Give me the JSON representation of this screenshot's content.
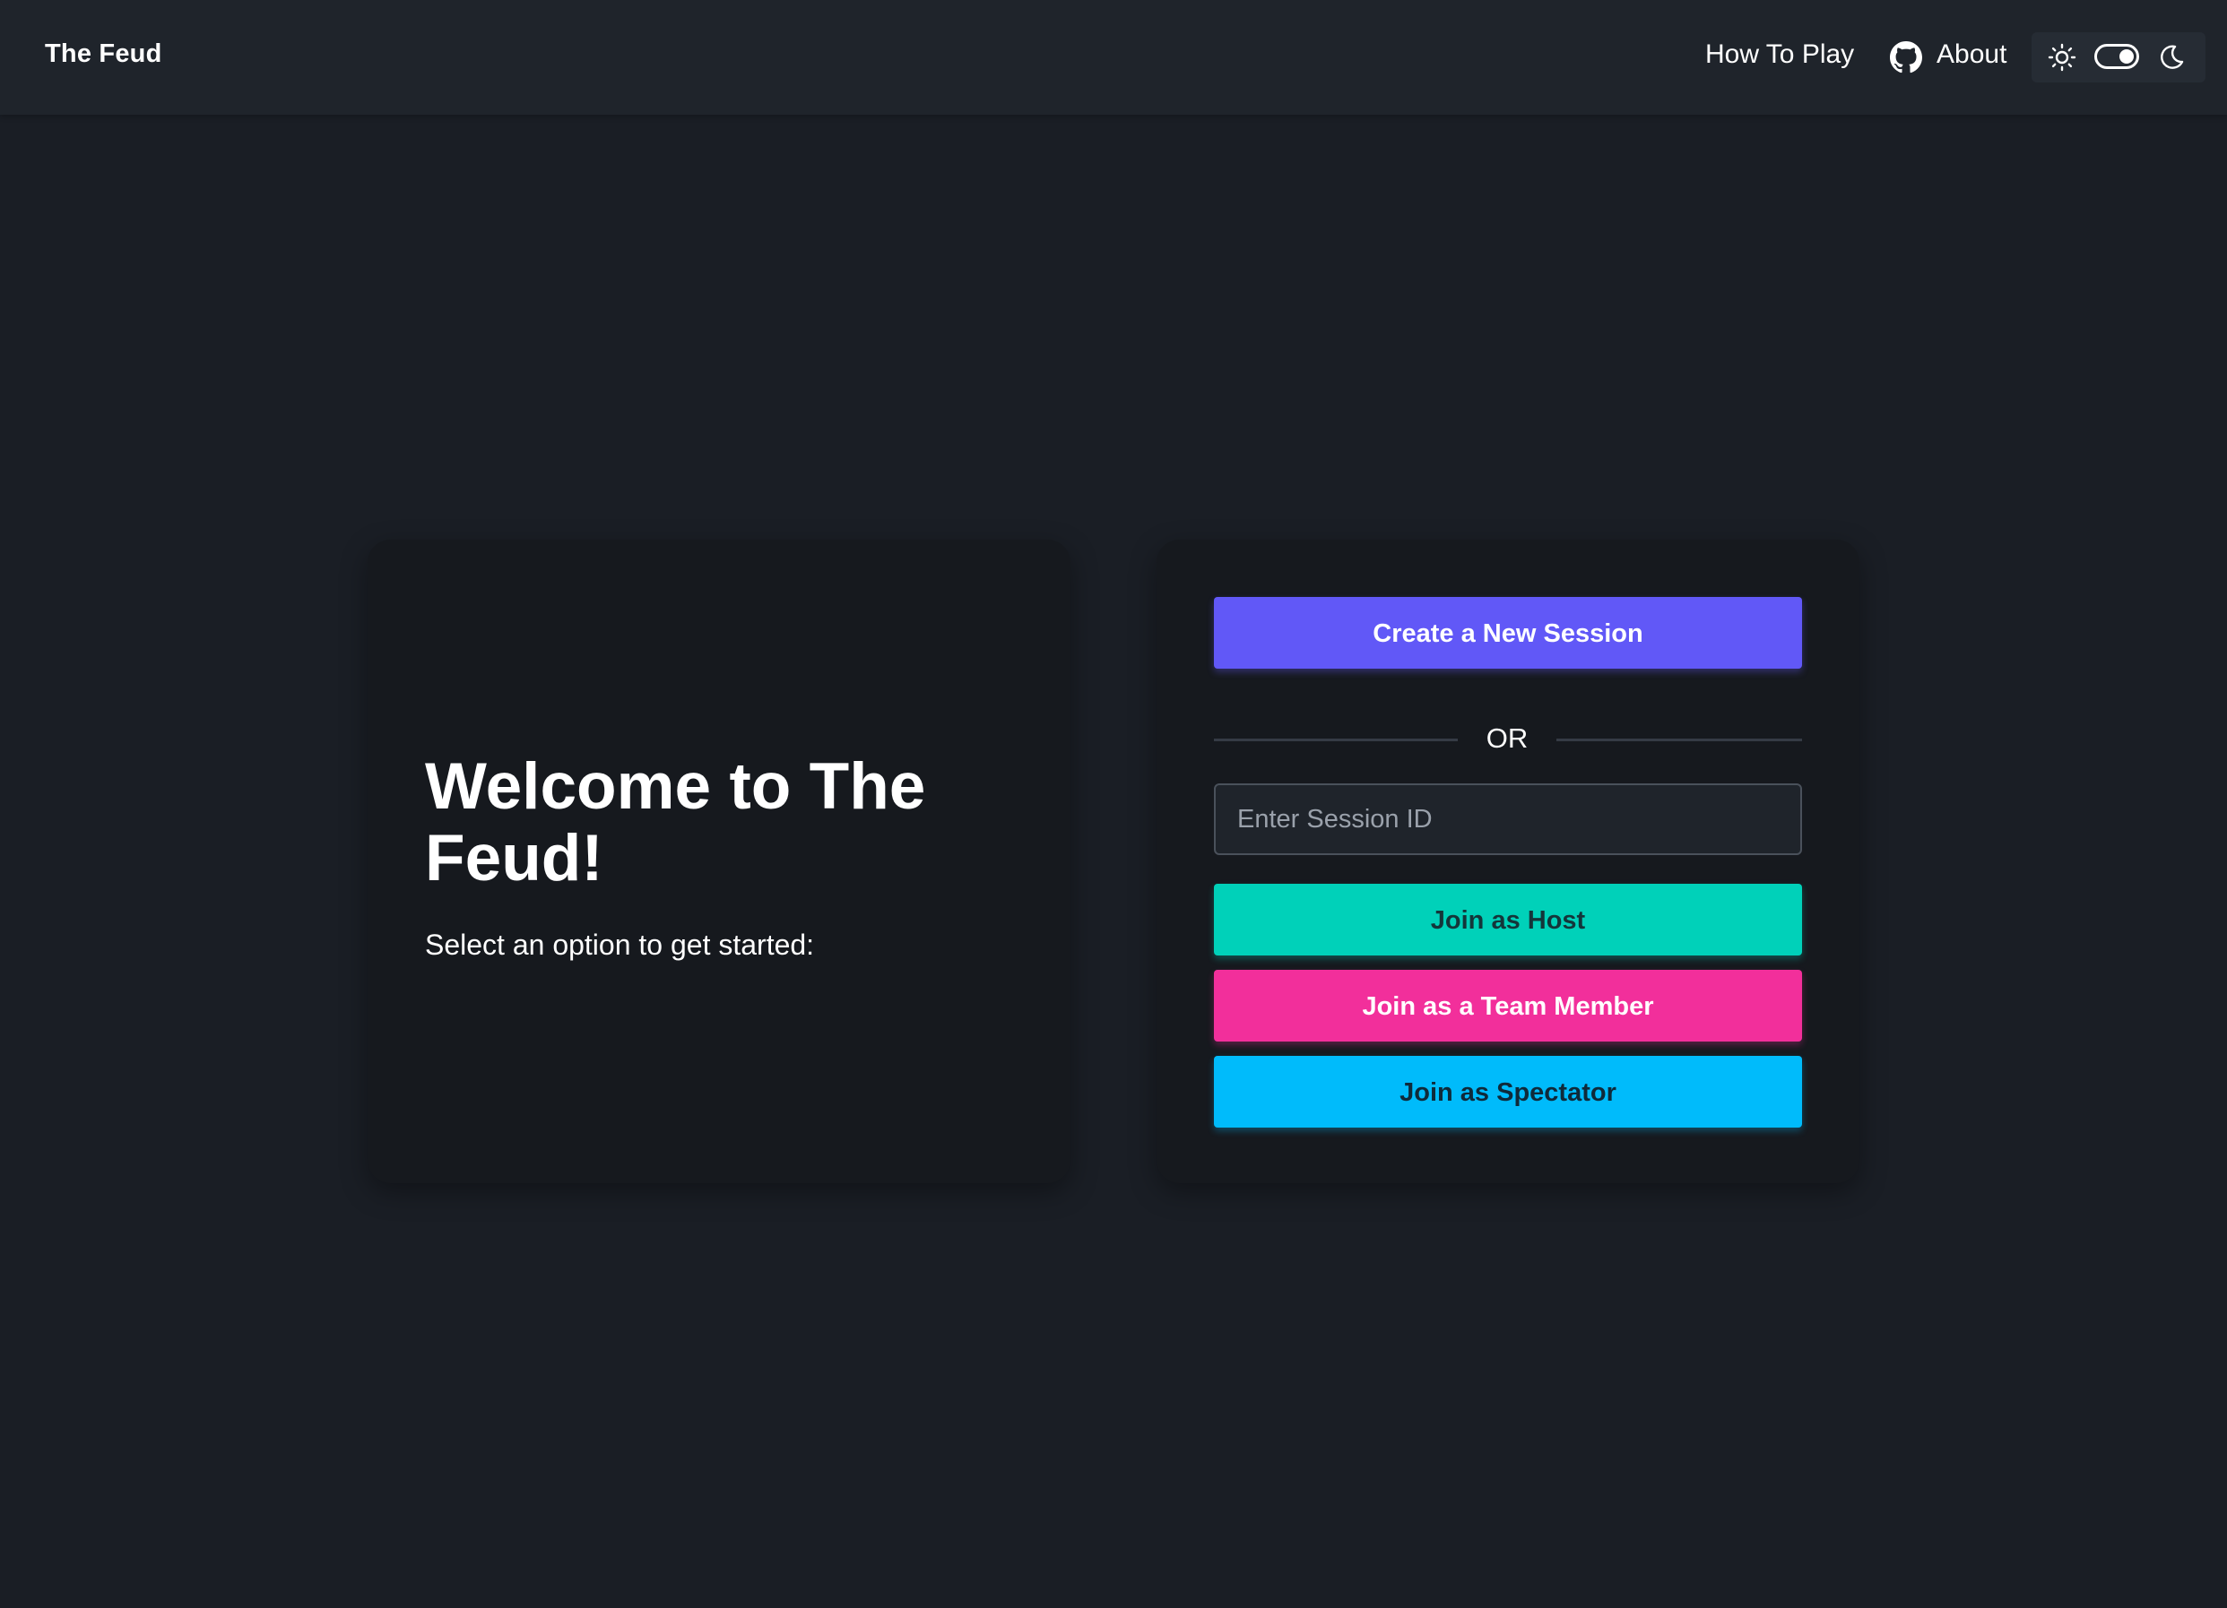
{
  "header": {
    "brand": "The Feud",
    "nav": {
      "how_to_play": "How To Play",
      "about": "About"
    },
    "icons": {
      "github": "github-icon",
      "sun": "sun-icon",
      "moon": "moon-icon"
    },
    "theme_toggle": {
      "state": "dark"
    }
  },
  "welcome": {
    "title": "Welcome to The Feud!",
    "subtitle": "Select an option to get started:"
  },
  "actions": {
    "create_label": "Create a New Session",
    "or_label": "OR",
    "session_input": {
      "placeholder": "Enter Session ID",
      "value": ""
    },
    "join_host_label": "Join as Host",
    "join_team_label": "Join as a Team Member",
    "join_spectator_label": "Join as Spectator"
  },
  "colors": {
    "background": "#1a1e25",
    "navbar": "#1f242b",
    "card": "#16191e",
    "create": "#6158f7",
    "host": "#00d1b9",
    "team": "#f22f9b",
    "spectator": "#00bbfb"
  }
}
